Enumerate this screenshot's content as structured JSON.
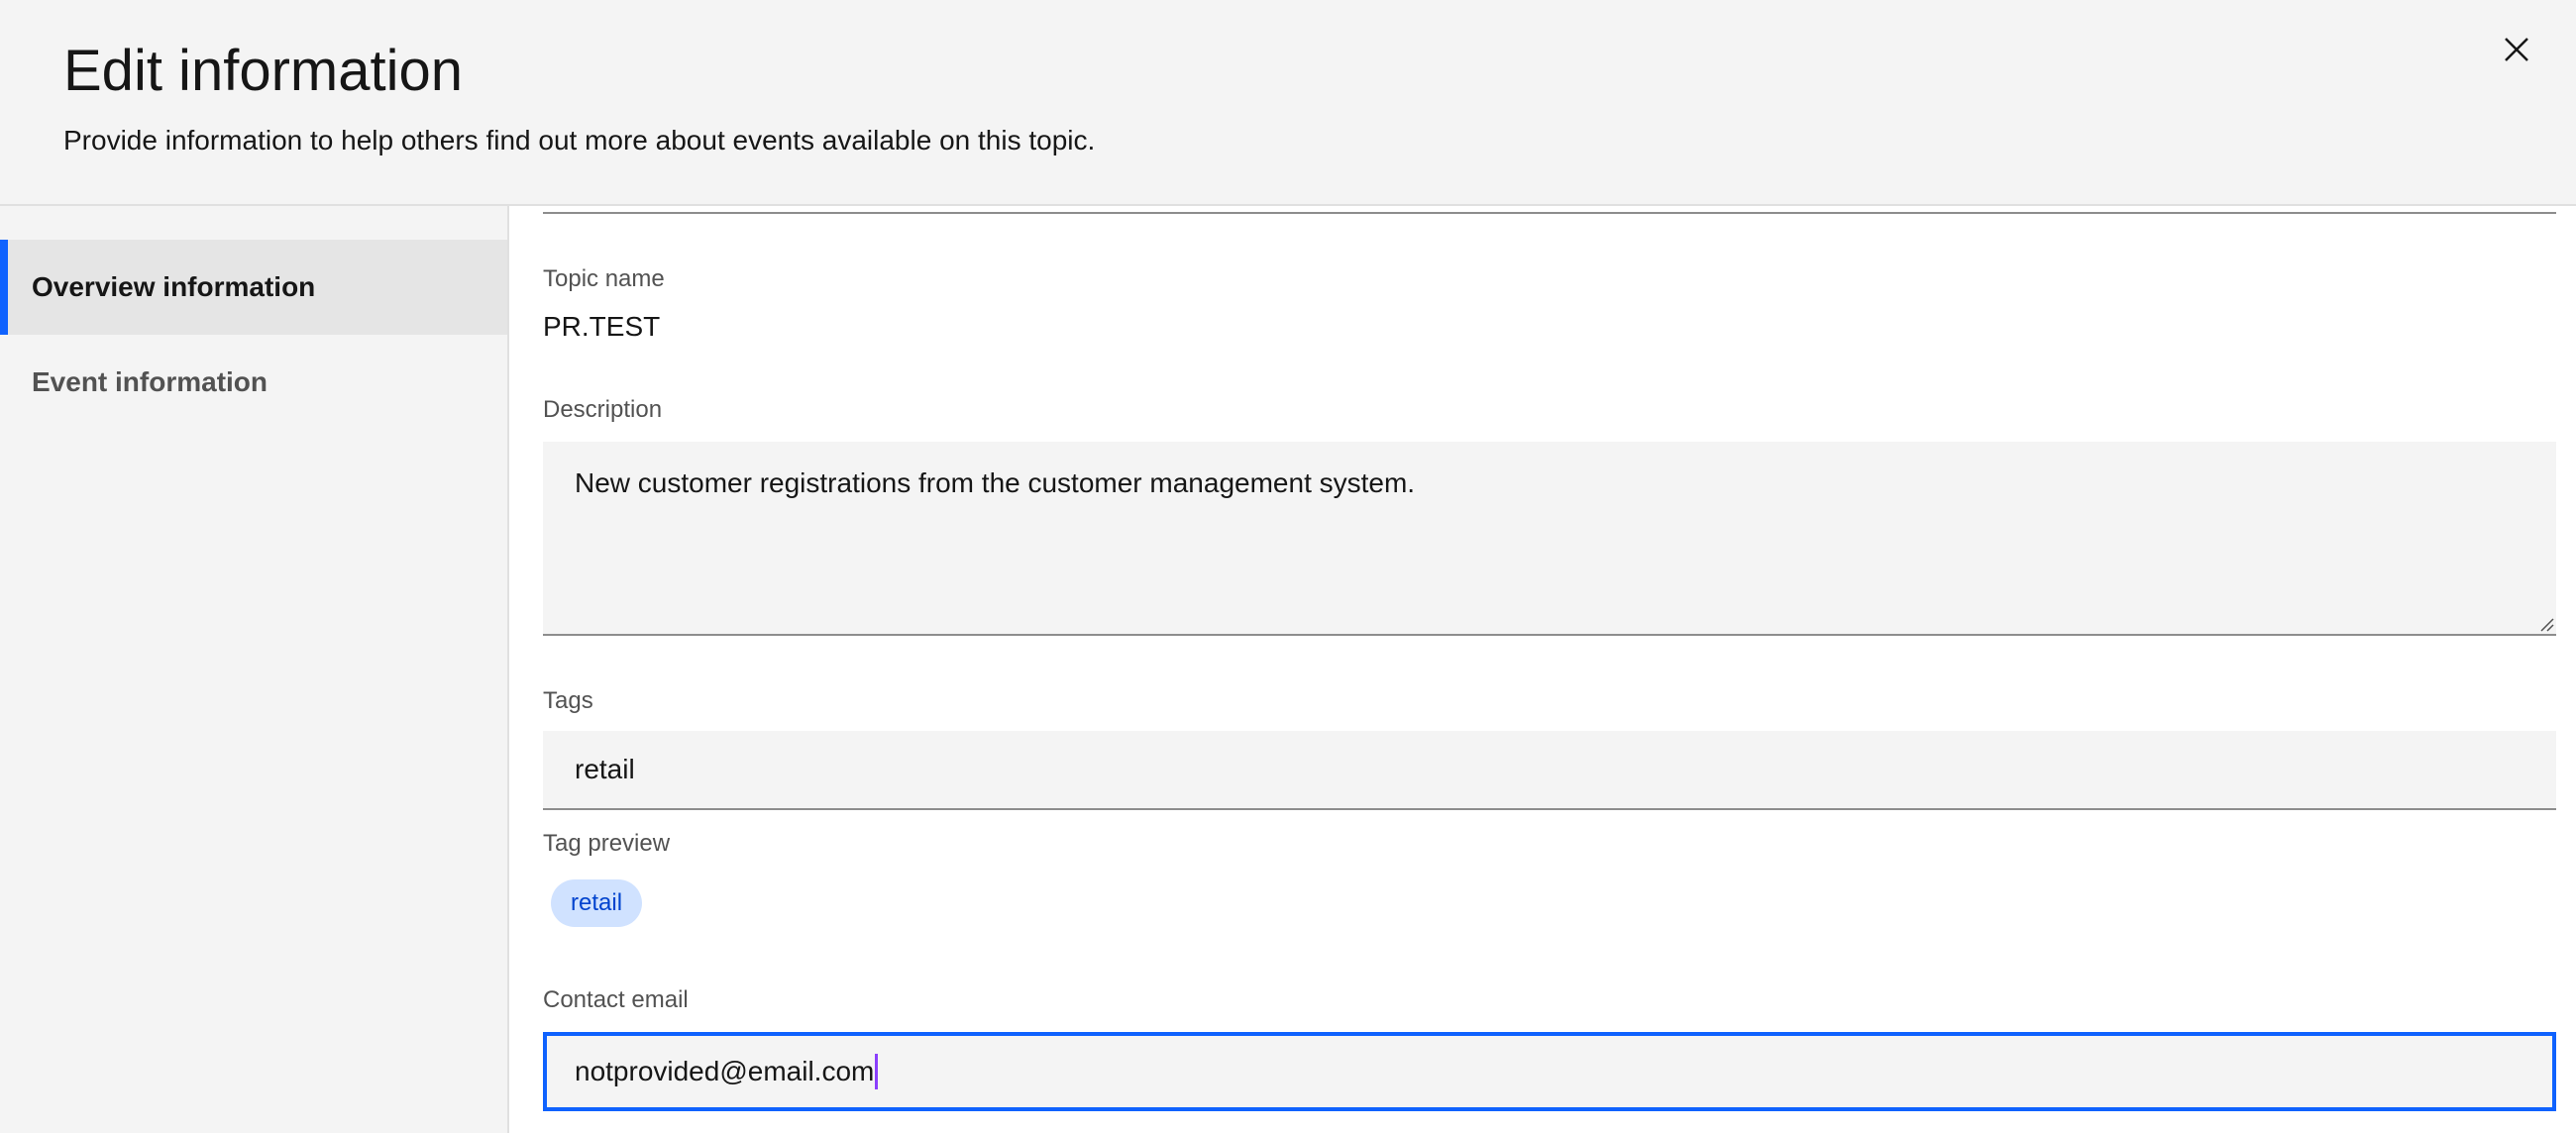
{
  "header": {
    "title": "Edit information",
    "subtitle": "Provide information to help others find out more about events available on this topic.",
    "close_icon": "close-icon"
  },
  "sidebar": {
    "items": [
      {
        "label": "Overview information",
        "active": true
      },
      {
        "label": "Event information",
        "active": false
      }
    ]
  },
  "form": {
    "topic_name": {
      "label": "Topic name",
      "value": "PR.TEST"
    },
    "description": {
      "label": "Description",
      "value": "New customer registrations from the customer management system."
    },
    "tags": {
      "label": "Tags",
      "value": "retail"
    },
    "tag_preview": {
      "label": "Tag preview",
      "tags": [
        "retail"
      ]
    },
    "contact_email": {
      "label": "Contact email",
      "value": "notprovided@email.com"
    }
  },
  "colors": {
    "accent": "#0f62fe",
    "tag_background": "#d0e2ff",
    "tag_text": "#0043ce",
    "caret": "#8a3ffc"
  }
}
